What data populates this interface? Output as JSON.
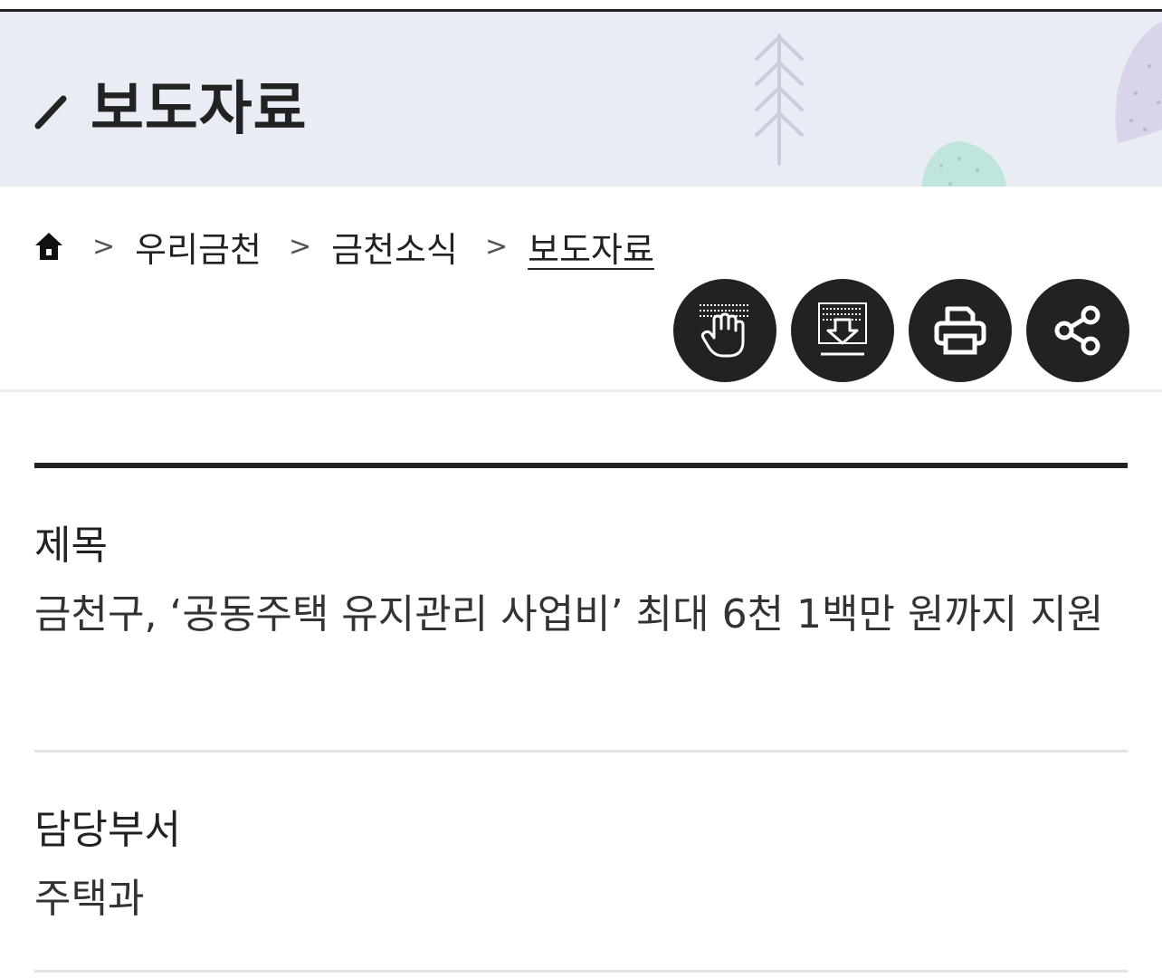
{
  "header": {
    "title": "보도자료",
    "colors": {
      "banner_bg": "#e8ecf4",
      "text": "#222222"
    }
  },
  "breadcrumb": {
    "home_icon": "home-icon",
    "separator": ">",
    "items": [
      "우리금천",
      "금천소식",
      "보도자료"
    ]
  },
  "actions": [
    {
      "icon": "touch-hand-icon"
    },
    {
      "icon": "download-icon"
    },
    {
      "icon": "print-icon"
    },
    {
      "icon": "share-icon"
    }
  ],
  "article": {
    "title_label": "제목",
    "title_value": "금천구, ‘공동주택 유지관리 사업비’ 최대 6천 1백만 원까지 지원",
    "dept_label": "담당부서",
    "dept_value": "주택과"
  }
}
